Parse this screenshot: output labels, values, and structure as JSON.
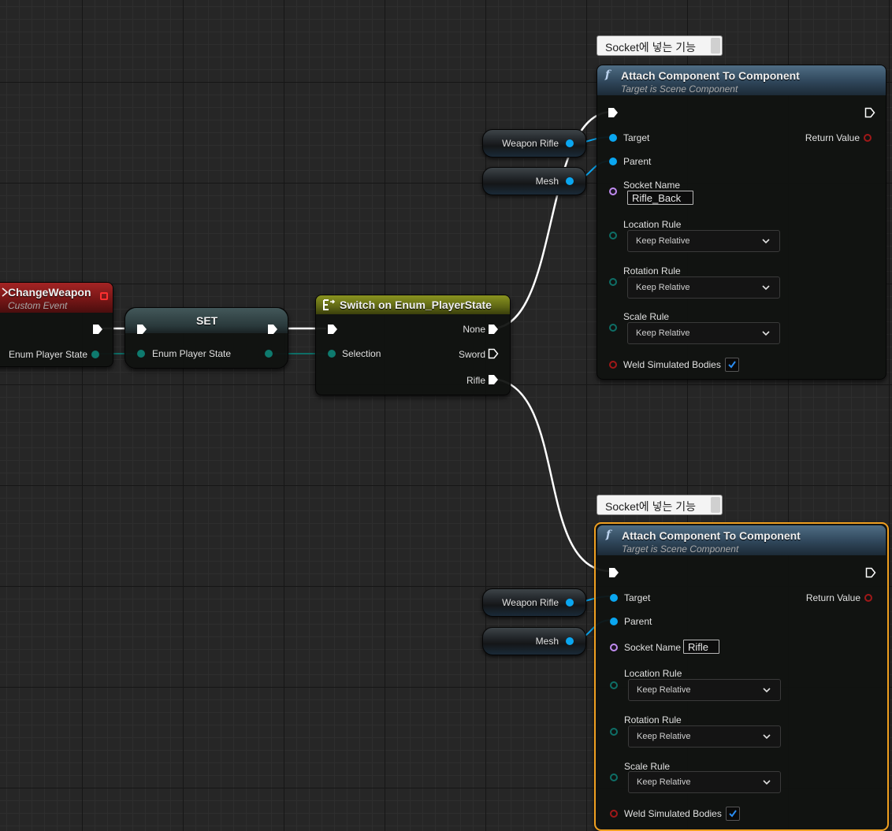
{
  "colors": {
    "grid_bg": "#262626",
    "exec_wire": "#ffffff",
    "object_pin": "#0aa6f0",
    "enum_pin": "#0e7a6e",
    "name_pin": "#c08cf0",
    "bool_pin": "#a01818",
    "selection_outline": "#f0a020"
  },
  "icons": {
    "function": "f-icon",
    "switch": "switch-enum-icon",
    "event": "event-diamond-icon",
    "exec": "exec-arrow-icon",
    "checkbox": "checkmark-icon",
    "dropdown": "chevron-down-icon"
  },
  "event_node": {
    "title": "ChangeWeapon",
    "subtitle": "Custom Event",
    "output_label": "Enum Player State"
  },
  "set_node": {
    "title": "SET",
    "input_label": "Enum Player State"
  },
  "switch_node": {
    "title": "Switch on Enum_PlayerState",
    "input_label": "Selection",
    "outputs": [
      "None",
      "Sword",
      "Rifle"
    ]
  },
  "variables": {
    "weapon_rifle": "Weapon Rifle",
    "mesh": "Mesh"
  },
  "attach_nodes": [
    {
      "comment": "Socket에 넣는 기능",
      "title": "Attach Component To Component",
      "subtitle": "Target is Scene Component",
      "target_label": "Target",
      "return_label": "Return Value",
      "parent_label": "Parent",
      "socket_label": "Socket Name",
      "socket_value": "Rifle_Back",
      "location_label": "Location Rule",
      "location_value": "Keep Relative",
      "rotation_label": "Rotation Rule",
      "rotation_value": "Keep Relative",
      "scale_label": "Scale Rule",
      "scale_value": "Keep Relative",
      "weld_label": "Weld Simulated Bodies",
      "weld_checked": true
    },
    {
      "comment": "Socket에 넣는 기능",
      "title": "Attach Component To Component",
      "subtitle": "Target is Scene Component",
      "target_label": "Target",
      "return_label": "Return Value",
      "parent_label": "Parent",
      "socket_label": "Socket Name",
      "socket_value": "Rifle",
      "location_label": "Location Rule",
      "location_value": "Keep Relative",
      "rotation_label": "Rotation Rule",
      "rotation_value": "Keep Relative",
      "scale_label": "Scale Rule",
      "scale_value": "Keep Relative",
      "weld_label": "Weld Simulated Bodies",
      "weld_checked": true
    }
  ]
}
